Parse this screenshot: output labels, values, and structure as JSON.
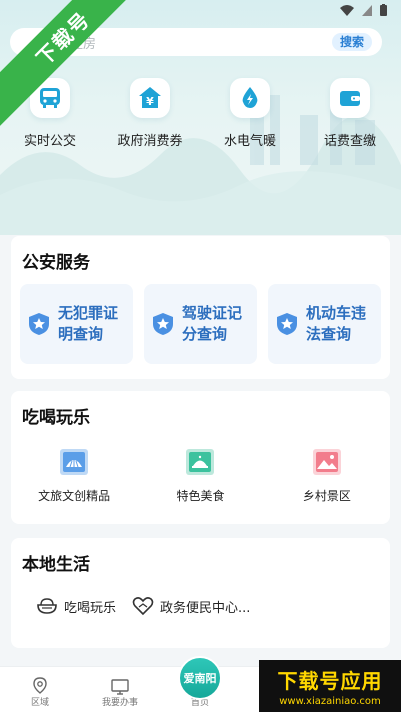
{
  "watermark_ribbon": "下载号",
  "search": {
    "placeholder": "住房",
    "button_label": "搜索"
  },
  "quick_services": [
    {
      "label": "实时公交",
      "icon": "bus-icon"
    },
    {
      "label": "政府消费券",
      "icon": "yuan-house-icon"
    },
    {
      "label": "水电气暖",
      "icon": "water-drop-icon"
    },
    {
      "label": "话费查缴",
      "icon": "wallet-icon"
    }
  ],
  "police": {
    "title": "公安服务",
    "items": [
      {
        "label": "无犯罪证明查询",
        "icon": "shield-star-icon"
      },
      {
        "label": "驾驶证记分查询",
        "icon": "shield-star-icon"
      },
      {
        "label": "机动车违法查询",
        "icon": "shield-star-icon"
      }
    ]
  },
  "fun": {
    "title": "吃喝玩乐",
    "items": [
      {
        "label": "文旅文创精品",
        "icon": "fan-icon"
      },
      {
        "label": "特色美食",
        "icon": "food-cloche-icon"
      },
      {
        "label": "乡村景区",
        "icon": "landscape-icon"
      }
    ]
  },
  "local": {
    "title": "本地生活",
    "items": [
      {
        "label": "吃喝玩乐",
        "icon": "bowl-icon"
      },
      {
        "label": "政务便民中心...",
        "icon": "heart-hands-icon"
      }
    ]
  },
  "nav": {
    "items": [
      {
        "label": "区域",
        "icon": "location-icon"
      },
      {
        "label": "我要办事",
        "icon": "monitor-icon"
      },
      {
        "label": "首页",
        "icon": "home-logo-icon"
      }
    ],
    "home_logo_text": "爱南阳"
  },
  "watermark_bottom": {
    "title": "下载号应用",
    "url": "www.xiazainiao.com"
  },
  "colors": {
    "accent_blue": "#2c6ebe",
    "ribbon_green": "#39b34a",
    "watermark_gold": "#ffd700"
  }
}
